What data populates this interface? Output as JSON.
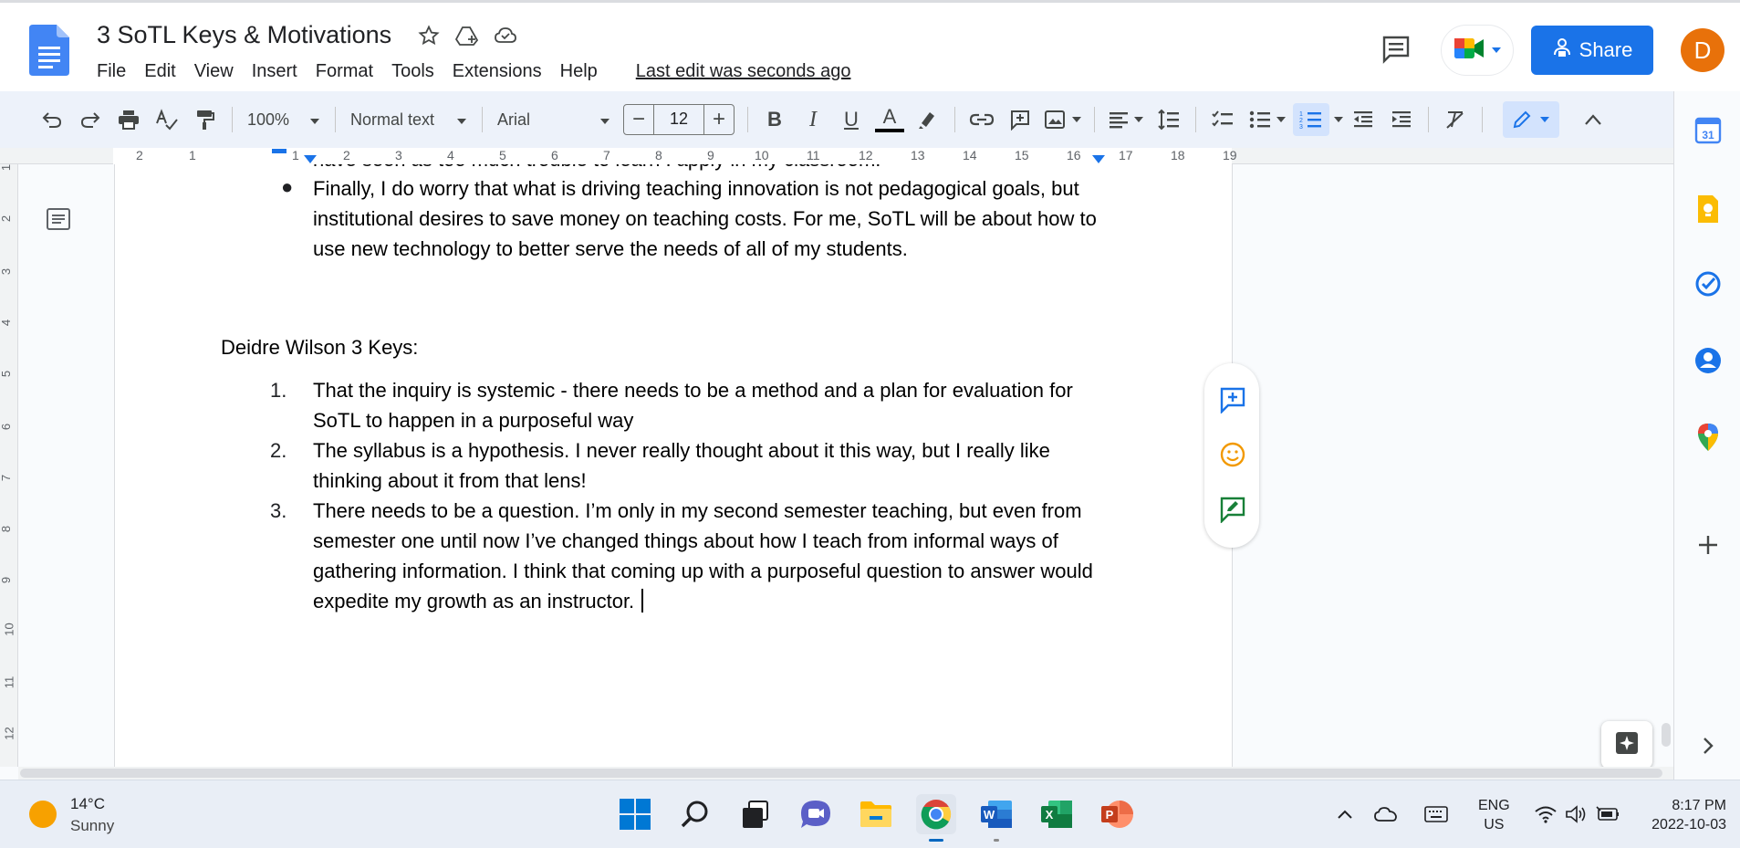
{
  "doc": {
    "title": "3 SoTL Keys & Motivations",
    "menu": [
      "File",
      "Edit",
      "View",
      "Insert",
      "Format",
      "Tools",
      "Extensions",
      "Help"
    ],
    "last_edit": "Last edit was seconds ago",
    "share_label": "Share",
    "avatar_initial": "D"
  },
  "toolbar": {
    "zoom": "100%",
    "style": "Normal text",
    "font": "Arial",
    "font_size": "12",
    "minus": "−",
    "plus": "+",
    "bold": "B",
    "italic": "I",
    "underline": "U",
    "text_color": "A"
  },
  "ruler": {
    "numbers": [
      "2",
      "1",
      "1",
      "2",
      "3",
      "4",
      "5",
      "6",
      "7",
      "8",
      "9",
      "10",
      "11",
      "12",
      "13",
      "14",
      "15",
      "16",
      "17",
      "18",
      "19"
    ],
    "vertical_numbers": [
      "1",
      "2",
      "3",
      "4",
      "5",
      "6",
      "7",
      "8",
      "9",
      "10",
      "11",
      "12"
    ]
  },
  "content": {
    "cutoff_line": "have seen as too much trouble to learn I apply in my classroom.",
    "bullet_symbol": "●",
    "bullet": "Finally, I do worry that what is driving teaching innovation is not pedagogical goals, but institutional desires to save money on teaching costs. For me, SoTL will be about how to use new technology to better serve the needs of all of my students.",
    "heading": "Deidre Wilson 3 Keys:",
    "list": [
      {
        "num": "1.",
        "text": "That the inquiry is systemic - there needs to be a method and a plan for evaluation for SoTL to happen in a purposeful way"
      },
      {
        "num": "2.",
        "text": "The syllabus is a hypothesis. I never really thought about it this way, but I really like thinking about it from that lens!"
      },
      {
        "num": "3.",
        "text": "There needs to be a question. I’m only in my second semester teaching, but even from semester one until now I’ve changed things about how I teach from informal ways of gathering information. I think that coming up with a purposeful question to answer would expedite my growth as an instructor."
      }
    ]
  },
  "taskbar": {
    "temperature": "14°C",
    "condition": "Sunny",
    "lang_top": "ENG",
    "lang_bottom": "US",
    "time": "8:17 PM",
    "date": "2022-10-03"
  },
  "side_panel": {
    "calendar_day": "31"
  },
  "colors": {
    "accent": "#1a73e8",
    "avatar": "#e8710a",
    "toolbar_bg": "#edf2fa"
  }
}
